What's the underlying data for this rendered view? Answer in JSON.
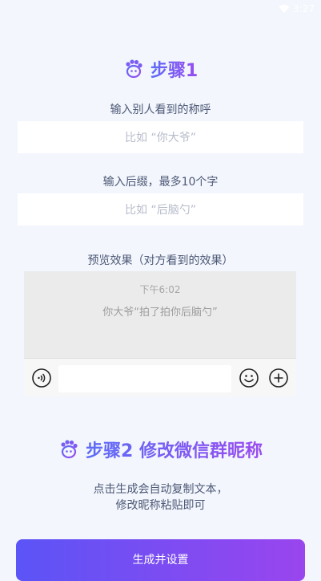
{
  "status": {
    "time": "3:27"
  },
  "step1": {
    "title": "步骤1",
    "name_label": "输入别人看到的称呼",
    "name_placeholder": "比如 “你大爷”",
    "suffix_label": "输入后缀，最多10个字",
    "suffix_placeholder": "比如 “后脑勺”",
    "preview_label": "预览效果（对方看到的效果）"
  },
  "preview": {
    "time": "下午6:02",
    "pat_text": "你大爷“拍了拍你后脑勺”"
  },
  "step2": {
    "title": "步骤2 修改微信群昵称",
    "desc_line1": "点击生成会自动复制文本，",
    "desc_line2": "修改昵称粘贴即可"
  },
  "cta": {
    "label": "生成并设置"
  },
  "colors": {
    "accent_start": "#5b54f6",
    "accent_end": "#9a45ee",
    "background": "#f3f6fc"
  }
}
